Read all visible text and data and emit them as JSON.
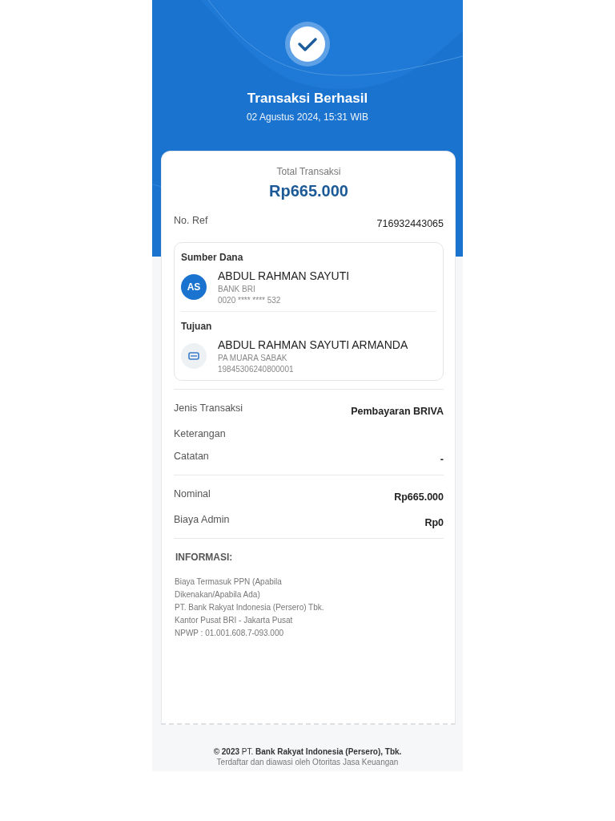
{
  "header": {
    "title": "Transaksi Berhasil",
    "datetime": "02 Agustus 2024, 15:31 WIB"
  },
  "receipt": {
    "total_label": "Total Transaksi",
    "total_amount": "Rp665.000",
    "ref": {
      "label": "No. Ref",
      "value": "716932443065"
    },
    "parties": [
      {
        "kind": "initials",
        "heading": "Sumber Dana",
        "initials": "AS",
        "name": "ABDUL RAHMAN SAYUTI",
        "bank": "BANK BRI",
        "account": "0020 **** **** 532"
      },
      {
        "kind": "card",
        "heading": "Tujuan",
        "name": "ABDUL RAHMAN SAYUTI ARMANDA",
        "bank": "PA MUARA SABAK",
        "account": "19845306240800001"
      }
    ],
    "details": [
      {
        "label": "Jenis Transaksi",
        "value": "Pembayaran BRIVA"
      },
      {
        "label": "Keterangan"
      },
      {
        "label": "Catatan",
        "value": "-"
      }
    ],
    "amounts": [
      {
        "label": "Nominal",
        "value": "Rp665.000"
      },
      {
        "label": "Biaya Admin",
        "value": "Rp0"
      }
    ],
    "info": {
      "heading": "INFORMASI:",
      "lines": [
        "Biaya Termasuk PPN (Apabila Dikenakan/Apabila Ada)",
        "PT. Bank Rakyat Indonesia (Persero) Tbk.",
        "Kantor Pusat BRI - Jakarta Pusat",
        "NPWP : 01.001.608.7-093.000"
      ]
    }
  },
  "footer": {
    "copyright": "**© 2023** PT. **Bank Rakyat Indonesia (Persero), Tbk.**",
    "regulator": "Terdaftar dan diawasi oleh Otoritas Jasa Keuangan"
  }
}
